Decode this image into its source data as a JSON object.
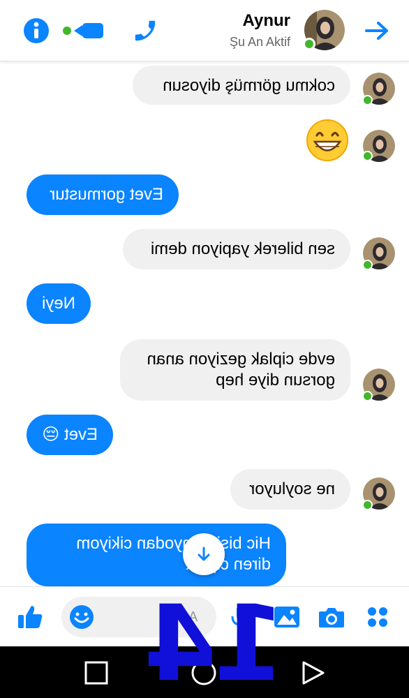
{
  "header": {
    "contact_name": "Aynur",
    "status": "Şu An Aktif"
  },
  "messages": [
    {
      "side": "in",
      "text": "cokmu görmüş diyosun"
    },
    {
      "side": "in",
      "emoji": "grinning-face"
    },
    {
      "side": "out",
      "text": "Evet gormustur"
    },
    {
      "side": "in",
      "text": "sen bilerek yapiyon demi"
    },
    {
      "side": "out",
      "text": "Neyi"
    },
    {
      "side": "in",
      "text": "evde ciplak geziyon anan gorsun diye hep"
    },
    {
      "side": "out",
      "text": "Evet 😔"
    },
    {
      "side": "in",
      "text": "ne soyluyor"
    },
    {
      "side": "out",
      "text": "Hic bisi Banyodan cikiyom diren ciplak"
    }
  ],
  "composer": {
    "placeholder": "A"
  },
  "overlay": {
    "number": "14"
  },
  "colors": {
    "accent": "#0a84ff",
    "incoming_bubble": "#f0f0f0",
    "online": "#42b72a",
    "overlay": "#1010d8"
  }
}
